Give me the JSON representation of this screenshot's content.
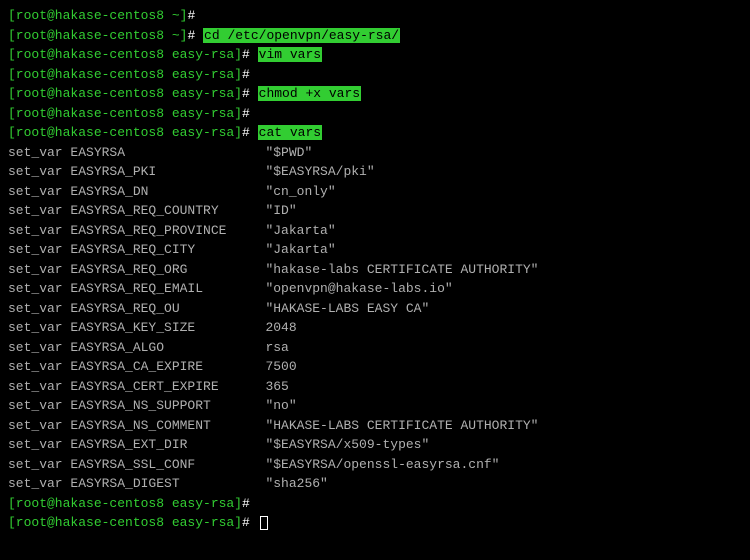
{
  "prompts": {
    "home": "[root@hakase-centos8 ~]#",
    "easyrsa": "[root@hakase-centos8 easy-rsa]#"
  },
  "lines": [
    {
      "type": "prompt",
      "prompt": "home",
      "cmd": ""
    },
    {
      "type": "prompt",
      "prompt": "home",
      "cmd": "cd /etc/openvpn/easy-rsa/",
      "hl": true
    },
    {
      "type": "prompt",
      "prompt": "easyrsa",
      "cmd": "vim vars",
      "hl": true
    },
    {
      "type": "prompt",
      "prompt": "easyrsa",
      "cmd": ""
    },
    {
      "type": "prompt",
      "prompt": "easyrsa",
      "cmd": "chmod +x vars",
      "hl": true
    },
    {
      "type": "prompt",
      "prompt": "easyrsa",
      "cmd": ""
    },
    {
      "type": "prompt",
      "prompt": "easyrsa",
      "cmd": "cat vars",
      "hl": true
    },
    {
      "type": "out",
      "key": "set_var EASYRSA",
      "val": "\"$PWD\""
    },
    {
      "type": "out",
      "key": "set_var EASYRSA_PKI",
      "val": "\"$EASYRSA/pki\""
    },
    {
      "type": "out",
      "key": "set_var EASYRSA_DN",
      "val": "\"cn_only\""
    },
    {
      "type": "out",
      "key": "set_var EASYRSA_REQ_COUNTRY",
      "val": "\"ID\""
    },
    {
      "type": "out",
      "key": "set_var EASYRSA_REQ_PROVINCE",
      "val": "\"Jakarta\""
    },
    {
      "type": "out",
      "key": "set_var EASYRSA_REQ_CITY",
      "val": "\"Jakarta\""
    },
    {
      "type": "out",
      "key": "set_var EASYRSA_REQ_ORG",
      "val": "\"hakase-labs CERTIFICATE AUTHORITY\""
    },
    {
      "type": "out",
      "key": "set_var EASYRSA_REQ_EMAIL",
      "val": "\"openvpn@hakase-labs.io\""
    },
    {
      "type": "out",
      "key": "set_var EASYRSA_REQ_OU",
      "val": "\"HAKASE-LABS EASY CA\""
    },
    {
      "type": "out",
      "key": "set_var EASYRSA_KEY_SIZE",
      "val": "2048"
    },
    {
      "type": "out",
      "key": "set_var EASYRSA_ALGO",
      "val": "rsa"
    },
    {
      "type": "out",
      "key": "set_var EASYRSA_CA_EXPIRE",
      "val": "7500"
    },
    {
      "type": "out",
      "key": "set_var EASYRSA_CERT_EXPIRE",
      "val": "365"
    },
    {
      "type": "out",
      "key": "set_var EASYRSA_NS_SUPPORT",
      "val": "\"no\""
    },
    {
      "type": "out",
      "key": "set_var EASYRSA_NS_COMMENT",
      "val": "\"HAKASE-LABS CERTIFICATE AUTHORITY\""
    },
    {
      "type": "out",
      "key": "set_var EASYRSA_EXT_DIR",
      "val": "\"$EASYRSA/x509-types\""
    },
    {
      "type": "out",
      "key": "set_var EASYRSA_SSL_CONF",
      "val": "\"$EASYRSA/openssl-easyrsa.cnf\""
    },
    {
      "type": "out",
      "key": "set_var EASYRSA_DIGEST",
      "val": "\"sha256\""
    },
    {
      "type": "prompt",
      "prompt": "easyrsa",
      "cmd": ""
    },
    {
      "type": "prompt",
      "prompt": "easyrsa",
      "cmd": "",
      "cursor": true
    }
  ],
  "outKeyWidth": 33
}
